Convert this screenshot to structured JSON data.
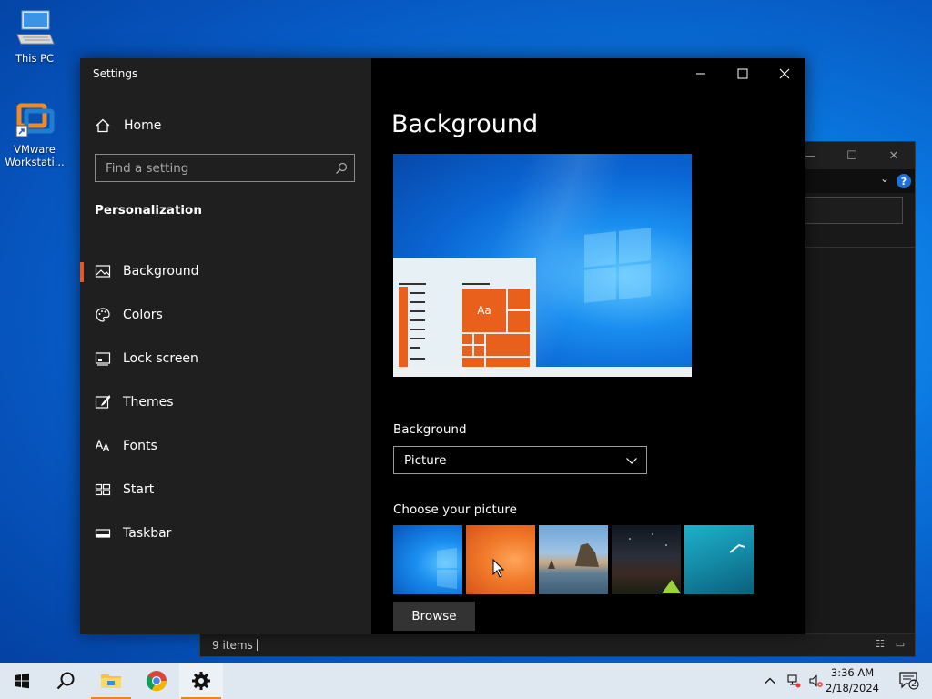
{
  "desktop": {
    "icons": [
      {
        "label": "This PC"
      },
      {
        "label": "VMware Workstati..."
      }
    ]
  },
  "explorer": {
    "status_text": "9 items"
  },
  "settings": {
    "app_title": "Settings",
    "home_label": "Home",
    "search": {
      "placeholder": "Find a setting"
    },
    "section_title": "Personalization",
    "nav": [
      {
        "label": "Background",
        "icon": "picture-icon",
        "active": true
      },
      {
        "label": "Colors",
        "icon": "palette-icon",
        "active": false
      },
      {
        "label": "Lock screen",
        "icon": "lock-screen-icon",
        "active": false
      },
      {
        "label": "Themes",
        "icon": "themes-brush-icon",
        "active": false
      },
      {
        "label": "Fonts",
        "icon": "fonts-icon",
        "active": false
      },
      {
        "label": "Start",
        "icon": "start-icon",
        "active": false
      },
      {
        "label": "Taskbar",
        "icon": "taskbar-icon",
        "active": false
      }
    ],
    "page_title": "Background",
    "preview_tile_text": "Aa",
    "background_label": "Background",
    "background_value": "Picture",
    "choose_picture_label": "Choose your picture",
    "browse_label": "Browse",
    "accent_color": "#e25a1c"
  },
  "taskbar": {
    "apps": [
      "start-icon",
      "search-icon",
      "file-explorer-icon",
      "chrome-icon",
      "settings-gear-icon"
    ],
    "clock": {
      "time": "3:36 AM",
      "date": "2/18/2024"
    },
    "notification_count": "2"
  }
}
